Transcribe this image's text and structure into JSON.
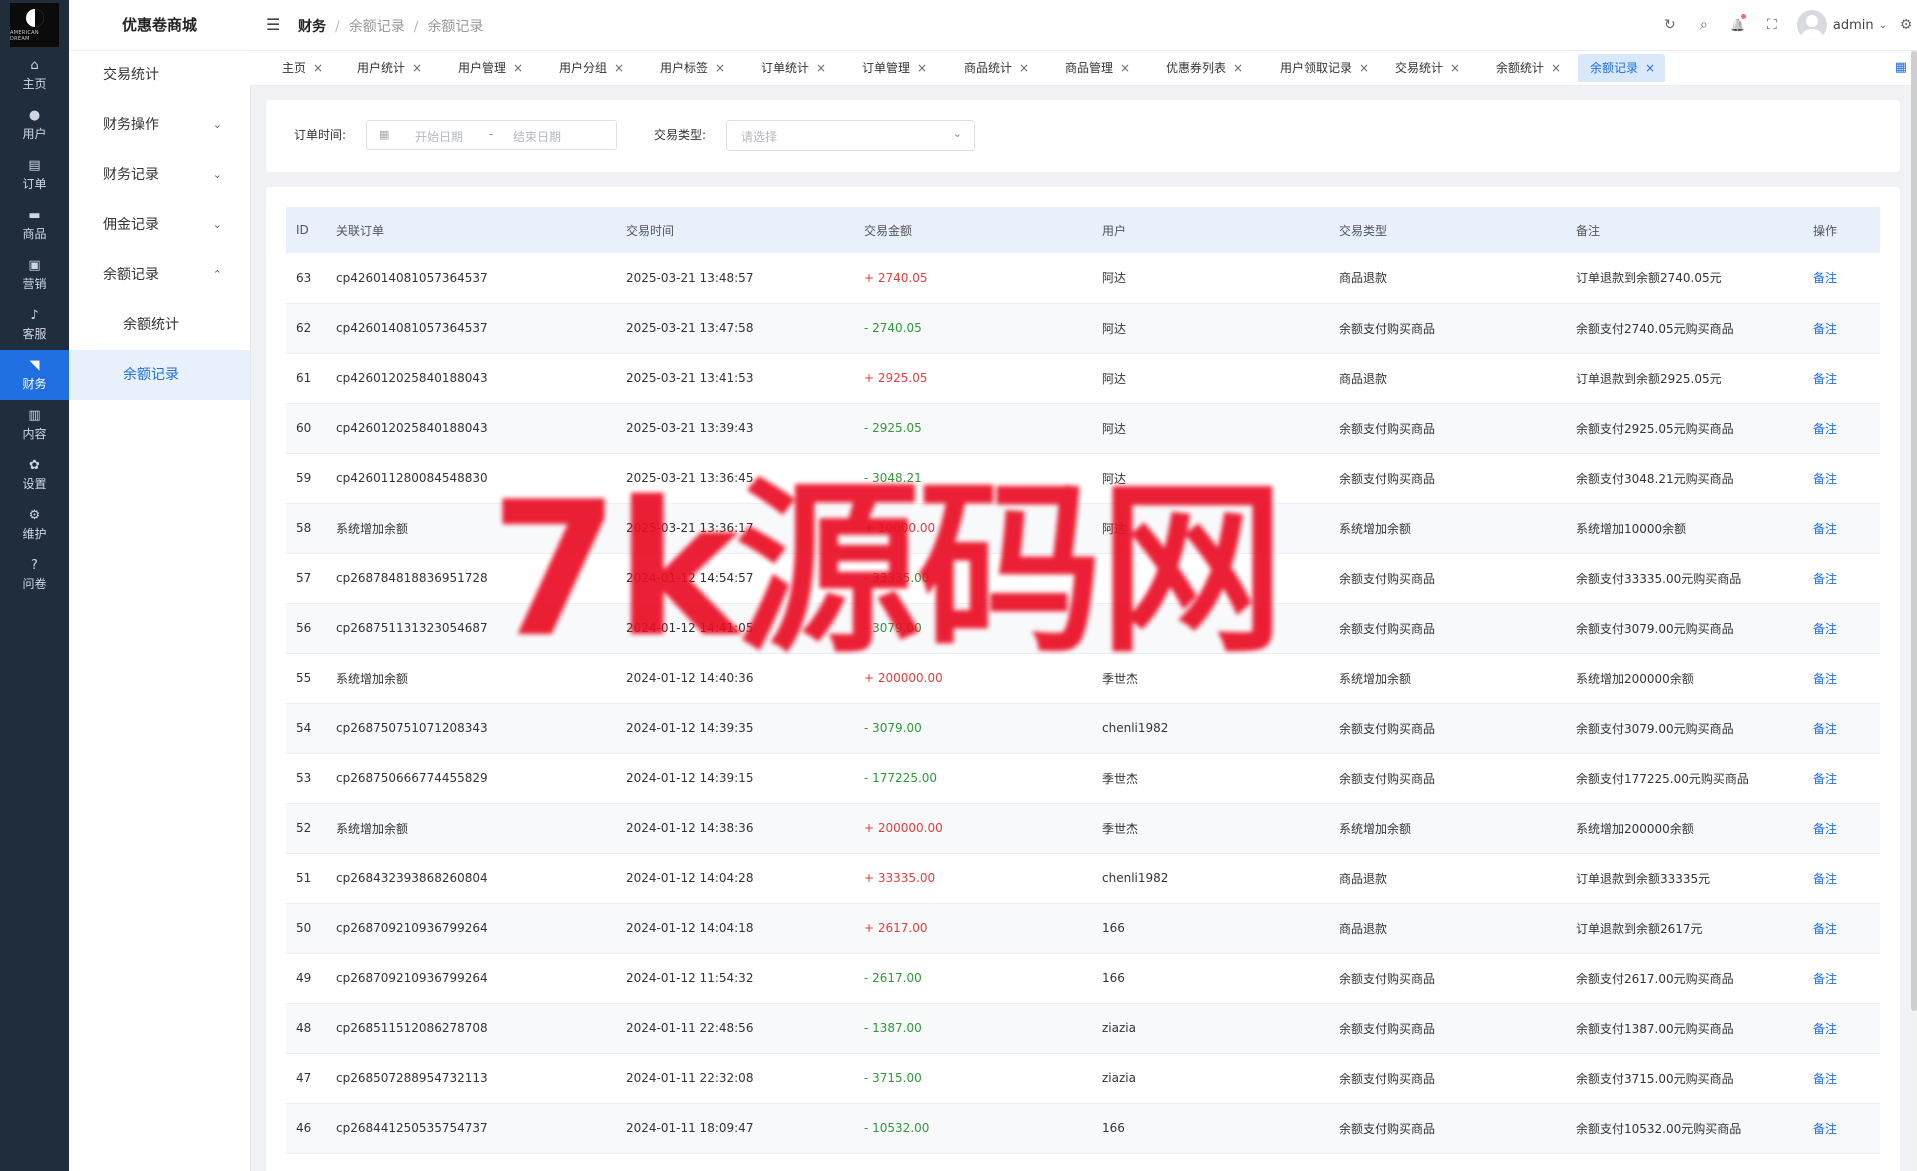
{
  "logo": {
    "subtext": "AMERICAN DREAM"
  },
  "rail": [
    {
      "icon": "⌂",
      "label": "主页"
    },
    {
      "icon": "●",
      "label": "用户"
    },
    {
      "icon": "▤",
      "label": "订单"
    },
    {
      "icon": "▬",
      "label": "商品"
    },
    {
      "icon": "▣",
      "label": "营销"
    },
    {
      "icon": "♪",
      "label": "客服"
    },
    {
      "icon": "◥",
      "label": "财务"
    },
    {
      "icon": "▥",
      "label": "内容"
    },
    {
      "icon": "✿",
      "label": "设置"
    },
    {
      "icon": "⚙",
      "label": "维护"
    },
    {
      "icon": "?",
      "label": "问卷"
    }
  ],
  "submenu": {
    "title": "优惠卷商城",
    "items": [
      {
        "label": "交易统计",
        "chevron": ""
      },
      {
        "label": "财务操作",
        "chevron": "⌄"
      },
      {
        "label": "财务记录",
        "chevron": "⌄"
      },
      {
        "label": "佣金记录",
        "chevron": "⌄"
      },
      {
        "label": "余额记录",
        "chevron": "⌃"
      },
      {
        "label": "余额统计",
        "chevron": ""
      },
      {
        "label": "余额记录",
        "chevron": ""
      }
    ]
  },
  "header": {
    "menu_icon": "☰",
    "breadcrumbs": [
      "财务",
      "余额记录",
      "余额记录"
    ],
    "icons": [
      "↻",
      "⌕",
      "🔔",
      "⛶"
    ],
    "user": "admin",
    "caret": "⌄",
    "settings_icon": "⚙"
  },
  "tabs": [
    {
      "label": "主页"
    },
    {
      "label": "用户统计"
    },
    {
      "label": "用户管理"
    },
    {
      "label": "用户分组"
    },
    {
      "label": "用户标签"
    },
    {
      "label": "订单统计"
    },
    {
      "label": "订单管理"
    },
    {
      "label": "商品统计"
    },
    {
      "label": "商品管理"
    },
    {
      "label": "优惠券列表"
    },
    {
      "label": "用户领取记录"
    },
    {
      "label": "交易统计"
    },
    {
      "label": "余额统计"
    },
    {
      "label": "余额记录"
    }
  ],
  "tab_close": "×",
  "tabs_grid_icon": "▦",
  "filter": {
    "order_time_label": "订单时间:",
    "start_placeholder": "开始日期",
    "range_sep": "-",
    "end_placeholder": "结束日期",
    "calendar_icon": "▦",
    "type_label": "交易类型:",
    "type_placeholder": "请选择",
    "arrow": "⌄"
  },
  "table": {
    "headers": [
      "ID",
      "关联订单",
      "交易时间",
      "交易金额",
      "用户",
      "交易类型",
      "备注",
      "操作"
    ],
    "rows": [
      {
        "id": "63",
        "order": "cp426014081057364537",
        "time": "2025-03-21 13:48:57",
        "amount": "+ 2740.05",
        "sign": "pos",
        "user": "阿达",
        "type": "商品退款",
        "note": "订单退款到余额2740.05元",
        "op": "备注"
      },
      {
        "id": "62",
        "order": "cp426014081057364537",
        "time": "2025-03-21 13:47:58",
        "amount": "- 2740.05",
        "sign": "neg",
        "user": "阿达",
        "type": "余额支付购买商品",
        "note": "余额支付2740.05元购买商品",
        "op": "备注"
      },
      {
        "id": "61",
        "order": "cp426012025840188043",
        "time": "2025-03-21 13:41:53",
        "amount": "+ 2925.05",
        "sign": "pos",
        "user": "阿达",
        "type": "商品退款",
        "note": "订单退款到余额2925.05元",
        "op": "备注"
      },
      {
        "id": "60",
        "order": "cp426012025840188043",
        "time": "2025-03-21 13:39:43",
        "amount": "- 2925.05",
        "sign": "neg",
        "user": "阿达",
        "type": "余额支付购买商品",
        "note": "余额支付2925.05元购买商品",
        "op": "备注"
      },
      {
        "id": "59",
        "order": "cp426011280084548830",
        "time": "2025-03-21 13:36:45",
        "amount": "- 3048.21",
        "sign": "neg",
        "user": "阿达",
        "type": "余额支付购买商品",
        "note": "余额支付3048.21元购买商品",
        "op": "备注"
      },
      {
        "id": "58",
        "order": "系统增加余额",
        "time": "2025-03-21 13:36:17",
        "amount": "+ 10000.00",
        "sign": "pos",
        "user": "阿达",
        "type": "系统增加余额",
        "note": "系统增加10000余额",
        "op": "备注"
      },
      {
        "id": "57",
        "order": "cp268784818836951728",
        "time": "2024-01-12 14:54:57",
        "amount": "- 33335.00",
        "sign": "neg",
        "user": "",
        "type": "余额支付购买商品",
        "note": "余额支付33335.00元购买商品",
        "op": "备注"
      },
      {
        "id": "56",
        "order": "cp268751131323054687",
        "time": "2024-01-12 14:41:05",
        "amount": "- 3079.00",
        "sign": "neg",
        "user": "",
        "type": "余额支付购买商品",
        "note": "余额支付3079.00元购买商品",
        "op": "备注"
      },
      {
        "id": "55",
        "order": "系统增加余额",
        "time": "2024-01-12 14:40:36",
        "amount": "+ 200000.00",
        "sign": "pos",
        "user": "季世杰",
        "type": "系统增加余额",
        "note": "系统增加200000余额",
        "op": "备注"
      },
      {
        "id": "54",
        "order": "cp268750751071208343",
        "time": "2024-01-12 14:39:35",
        "amount": "- 3079.00",
        "sign": "neg",
        "user": "chenli1982",
        "type": "余额支付购买商品",
        "note": "余额支付3079.00元购买商品",
        "op": "备注"
      },
      {
        "id": "53",
        "order": "cp268750666774455829",
        "time": "2024-01-12 14:39:15",
        "amount": "- 177225.00",
        "sign": "neg",
        "user": "季世杰",
        "type": "余额支付购买商品",
        "note": "余额支付177225.00元购买商品",
        "op": "备注"
      },
      {
        "id": "52",
        "order": "系统增加余额",
        "time": "2024-01-12 14:38:36",
        "amount": "+ 200000.00",
        "sign": "pos",
        "user": "季世杰",
        "type": "系统增加余额",
        "note": "系统增加200000余额",
        "op": "备注"
      },
      {
        "id": "51",
        "order": "cp268432393868260804",
        "time": "2024-01-12 14:04:28",
        "amount": "+ 33335.00",
        "sign": "pos",
        "user": "chenli1982",
        "type": "商品退款",
        "note": "订单退款到余额33335元",
        "op": "备注"
      },
      {
        "id": "50",
        "order": "cp268709210936799264",
        "time": "2024-01-12 14:04:18",
        "amount": "+ 2617.00",
        "sign": "pos",
        "user": "166",
        "type": "商品退款",
        "note": "订单退款到余额2617元",
        "op": "备注"
      },
      {
        "id": "49",
        "order": "cp268709210936799264",
        "time": "2024-01-12 11:54:32",
        "amount": "- 2617.00",
        "sign": "neg",
        "user": "166",
        "type": "余额支付购买商品",
        "note": "余额支付2617.00元购买商品",
        "op": "备注"
      },
      {
        "id": "48",
        "order": "cp268511512086278708",
        "time": "2024-01-11 22:48:56",
        "amount": "- 1387.00",
        "sign": "neg",
        "user": "ziazia",
        "type": "余额支付购买商品",
        "note": "余额支付1387.00元购买商品",
        "op": "备注"
      },
      {
        "id": "47",
        "order": "cp268507288954732113",
        "time": "2024-01-11 22:32:08",
        "amount": "- 3715.00",
        "sign": "neg",
        "user": "ziazia",
        "type": "余额支付购买商品",
        "note": "余额支付3715.00元购买商品",
        "op": "备注"
      },
      {
        "id": "46",
        "order": "cp268441250535754737",
        "time": "2024-01-11 18:09:47",
        "amount": "- 10532.00",
        "sign": "neg",
        "user": "166",
        "type": "余额支付购买商品",
        "note": "余额支付10532.00元购买商品",
        "op": "备注"
      }
    ]
  },
  "watermark": "7k源码网",
  "colors": {
    "accent": "#1f6fe0",
    "positive": "#e23e3e",
    "negative": "#2f9a3a",
    "watermark": "#ea0d24"
  }
}
